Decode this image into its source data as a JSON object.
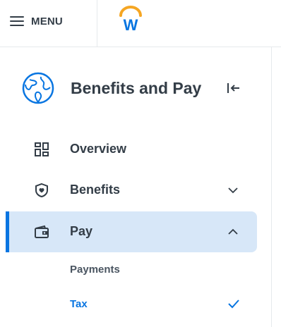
{
  "topbar": {
    "menu_label": "MENU",
    "logo_letter": "W",
    "logo_colors": {
      "arc": "#f5a623",
      "letter": "#0875e1"
    }
  },
  "panel": {
    "title": "Benefits and Pay",
    "header_icon": "globe-icon",
    "collapse_icon": "collapse-left-icon",
    "items": [
      {
        "label": "Overview",
        "icon": "dashboard-grid-icon",
        "expandable": false,
        "active": false
      },
      {
        "label": "Benefits",
        "icon": "shield-icon",
        "expandable": true,
        "expanded": false,
        "active": false
      },
      {
        "label": "Pay",
        "icon": "wallet-icon",
        "expandable": true,
        "expanded": true,
        "active": true
      }
    ],
    "subitems": [
      {
        "label": "Payments",
        "selected": false
      },
      {
        "label": "Tax",
        "selected": true
      }
    ]
  },
  "colors": {
    "accent": "#0875e1",
    "active_bg": "#d7e7f8",
    "text": "#333d47",
    "divider": "#e6e9ec"
  }
}
